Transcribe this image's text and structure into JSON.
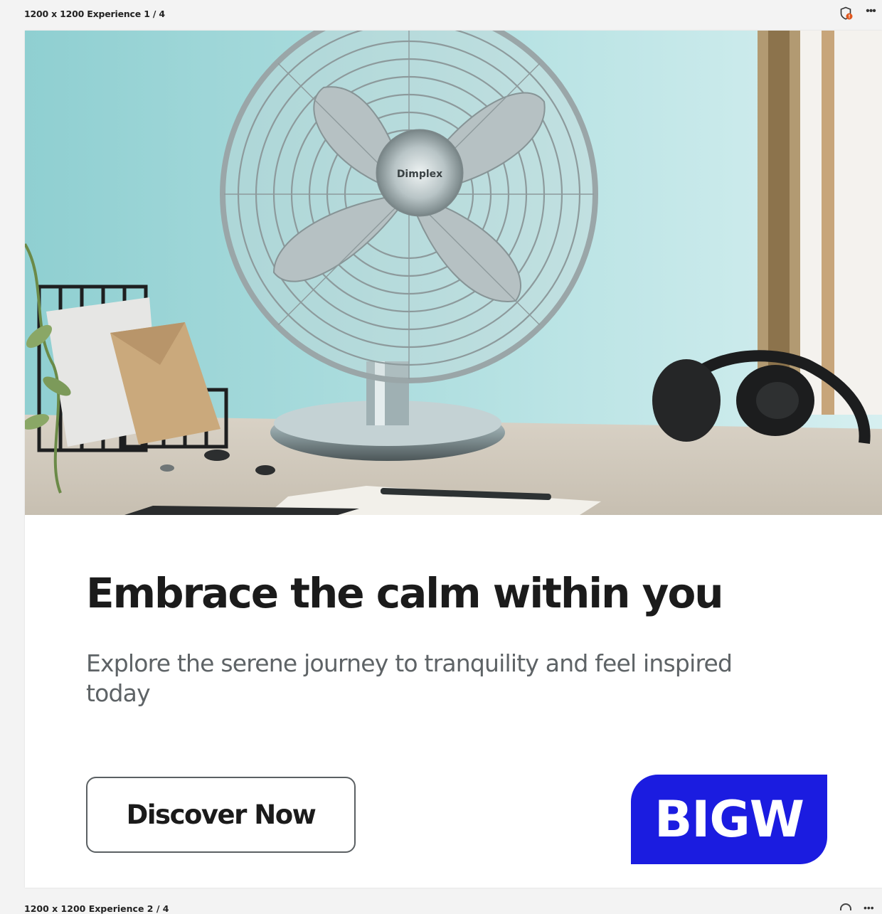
{
  "frame": {
    "title": "1200 x 1200 Experience 1 / 4",
    "more_label": "•••"
  },
  "next_frame": {
    "title": "1200 x 1200 Experience 2 / 4"
  },
  "hero": {
    "fan_brand": "Dimplex"
  },
  "ad": {
    "headline": "Embrace the calm within you",
    "subline": "Explore the serene journey to tranquility and feel inspired today",
    "cta_label": "Discover Now",
    "logo_text": "BIGW"
  },
  "colors": {
    "logo_bg": "#1b1ce0",
    "wall": "#a8dcdd",
    "headline": "#1b1b1b",
    "subline": "#5e6366"
  },
  "icons": {
    "shield": "shield-warning-icon",
    "more": "more-horizontal-icon"
  }
}
